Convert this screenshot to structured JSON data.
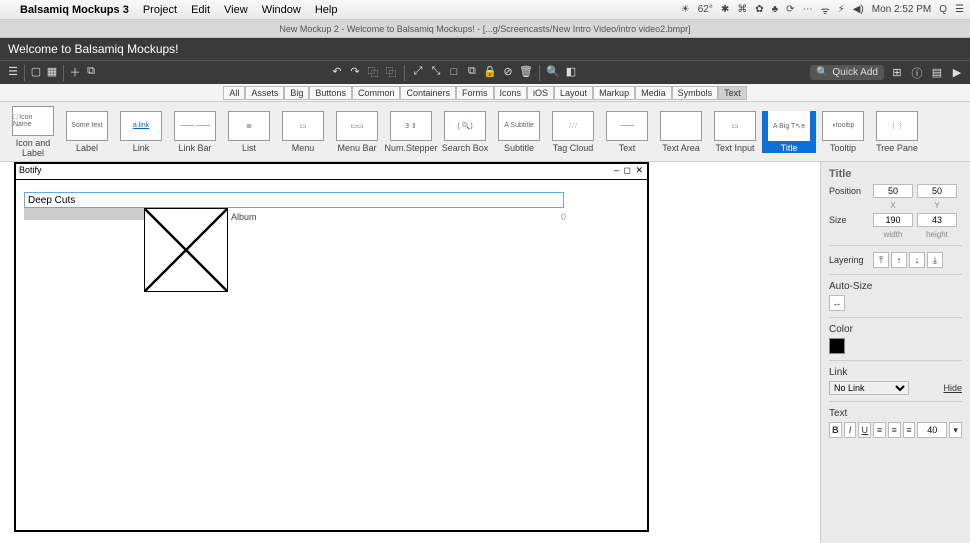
{
  "os_menu": {
    "app": "Balsamiq Mockups 3",
    "items": [
      "Project",
      "Edit",
      "View",
      "Window",
      "Help"
    ],
    "status": [
      "☀︎",
      "62°",
      "✱",
      "⌘",
      "✿",
      "♣",
      "⟳",
      "⋯",
      "ᯤ",
      "⚡︎",
      "◀︎)"
    ],
    "clock": "Mon 2:52 PM",
    "extras": [
      "Q",
      "☰"
    ]
  },
  "doc_tab": "New Mockup 2 - Welcome to Balsamiq Mockups! - [...g/Screencasts/New Intro Video/intro video2.bmpr]",
  "titlebar": "Welcome to Balsamiq Mockups!",
  "toolbar": {
    "quickadd_label": "Quick Add",
    "mid_icons": [
      "↶",
      "↷",
      "⿻",
      "⿻",
      "⿶",
      "⤢",
      "⤡",
      "□",
      "⧉",
      "🔒",
      "⊘",
      "🗑",
      "",
      "🔍",
      "◧"
    ]
  },
  "filters": [
    "All",
    "Assets",
    "Big",
    "Buttons",
    "Common",
    "Containers",
    "Forms",
    "Icons",
    "iOS",
    "Layout",
    "Markup",
    "Media",
    "Symbols",
    "Text"
  ],
  "filter_selected": "Text",
  "library": [
    {
      "label": "Icon and Label",
      "thumb": "□\nIcon Name"
    },
    {
      "label": "Label",
      "thumb": "Some text"
    },
    {
      "label": "Link",
      "thumb": "a link",
      "link": true
    },
    {
      "label": "Link Bar",
      "thumb": "—— ——"
    },
    {
      "label": "List",
      "thumb": "≣"
    },
    {
      "label": "Menu",
      "thumb": "▭"
    },
    {
      "label": "Menu Bar",
      "thumb": "▭▭"
    },
    {
      "label": "Num.Stepper",
      "thumb": "3 ⇕"
    },
    {
      "label": "Search Box",
      "thumb": "(  🔍)"
    },
    {
      "label": "Subtitle",
      "thumb": "A Subtitle"
    },
    {
      "label": "Tag Cloud",
      "thumb": "∴∵"
    },
    {
      "label": "Text",
      "thumb": "——"
    },
    {
      "label": "Text Area",
      "thumb": ""
    },
    {
      "label": "Text Input",
      "thumb": "▭"
    },
    {
      "label": "Title",
      "thumb": "A Big T↖e",
      "selected": true
    },
    {
      "label": "Tooltip",
      "thumb": "◖tooltip"
    },
    {
      "label": "Tree Pane",
      "thumb": "⋮⋮"
    }
  ],
  "mockup": {
    "window_title": "Botify",
    "window_controls": "– ◻ ✕",
    "editing_text": "Deep Cuts",
    "album_label": "Album",
    "album_count": "0"
  },
  "inspector": {
    "section": "Title",
    "position_label": "Position",
    "pos_x": "50",
    "pos_y": "50",
    "x_lbl": "X",
    "y_lbl": "Y",
    "size_label": "Size",
    "width": "190",
    "height": "43",
    "w_lbl": "width",
    "h_lbl": "height",
    "layering_label": "Layering",
    "autosize_label": "Auto-Size",
    "color_label": "Color",
    "link_label": "Link",
    "link_value": "No Link",
    "hide_label": "Hide",
    "text_label": "Text",
    "fontsize": "40"
  }
}
